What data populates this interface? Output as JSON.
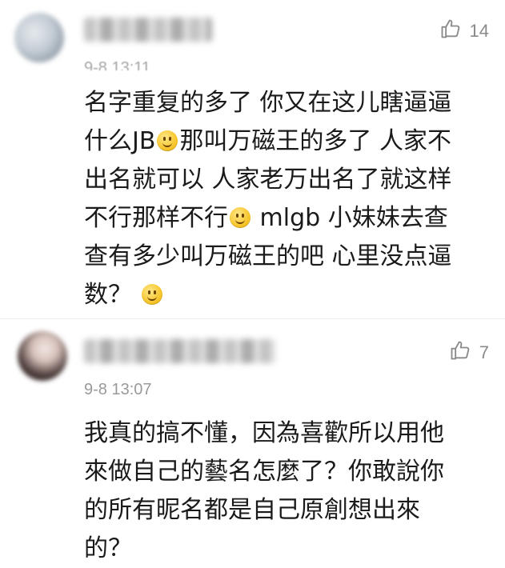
{
  "comments": [
    {
      "username": "",
      "timestamp": "9-8 13:11",
      "likes": "14",
      "lines": [
        [
          "名字重复的多了 你又在这儿瞎逼逼"
        ],
        [
          "什么JB",
          "[smile]",
          "那叫万磁王的多了 人家不"
        ],
        [
          "出名就可以 人家老万出名了就这样"
        ],
        [
          "不行那样不行",
          "[smile]",
          " mlgb 小妹妹去查"
        ],
        [
          "查有多少叫万磁王的吧 心里没点逼"
        ],
        [
          "数？ ",
          "[smile]"
        ]
      ]
    },
    {
      "username": "",
      "timestamp": "9-8 13:07",
      "likes": "7",
      "lines": [
        [
          "我真的搞不懂，因為喜歡所以用他"
        ],
        [
          "來做自己的藝名怎麼了？你敢說你"
        ],
        [
          "的所有昵名都是自己原創想出來"
        ],
        [
          "的？"
        ]
      ]
    }
  ],
  "icons": {
    "like": "thumbs-up-icon",
    "emoji": "smile-emoji-icon"
  }
}
